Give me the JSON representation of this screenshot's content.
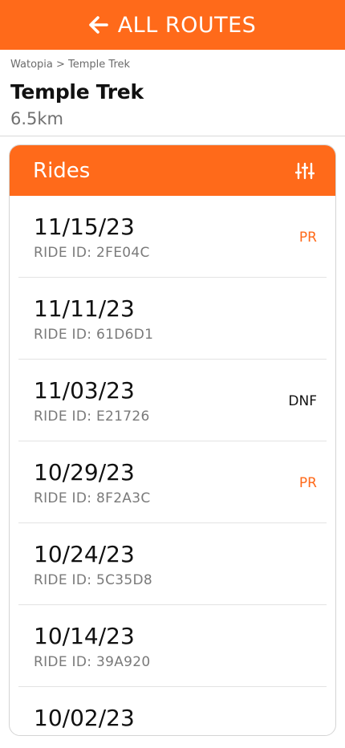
{
  "colors": {
    "accent": "#FF6A1A",
    "white": "#FFFFFF",
    "text_dark": "#111111",
    "text_muted": "#7A7A7A"
  },
  "header": {
    "back_icon": "arrow-left-icon",
    "title": "ALL ROUTES"
  },
  "breadcrumb": "Watopia > Temple Trek",
  "route": {
    "name": "Temple Trek",
    "distance": "6.5km"
  },
  "rides_panel": {
    "title": "Rides",
    "filter_icon": "sliders-icon",
    "items": [
      {
        "date": "11/15/23",
        "ride_id": "RIDE ID: 2FE04C",
        "tag": "PR",
        "tag_color": "#FF6A1A"
      },
      {
        "date": "11/11/23",
        "ride_id": "RIDE ID: 61D6D1",
        "tag": "",
        "tag_color": "#111111"
      },
      {
        "date": "11/03/23",
        "ride_id": "RIDE ID: E21726",
        "tag": "DNF",
        "tag_color": "#111111"
      },
      {
        "date": "10/29/23",
        "ride_id": "RIDE ID: 8F2A3C",
        "tag": "PR",
        "tag_color": "#FF6A1A"
      },
      {
        "date": "10/24/23",
        "ride_id": "RIDE ID: 5C35D8",
        "tag": "",
        "tag_color": "#111111"
      },
      {
        "date": "10/14/23",
        "ride_id": "RIDE ID: 39A920",
        "tag": "",
        "tag_color": "#111111"
      },
      {
        "date": "10/02/23",
        "ride_id": "",
        "tag": "",
        "tag_color": "#111111"
      }
    ]
  }
}
